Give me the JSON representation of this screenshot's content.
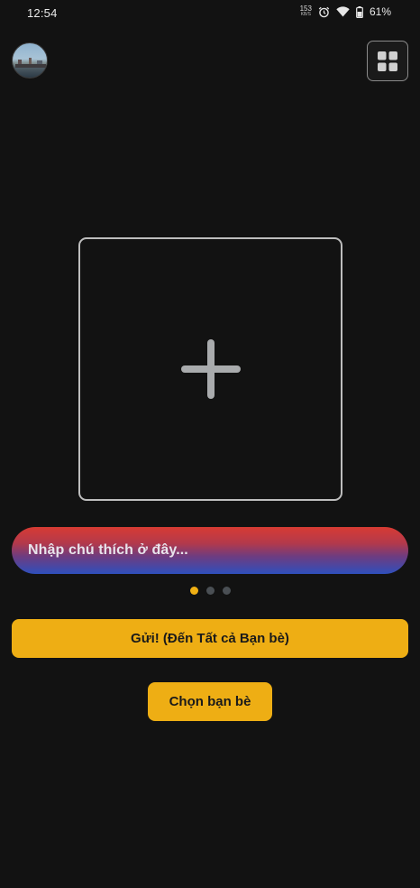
{
  "status_bar": {
    "time": "12:54",
    "net_speed_value": "153",
    "net_speed_unit": "KB/S",
    "alarm_icon": "alarm-icon",
    "wifi_icon": "wifi-icon",
    "battery_icon": "battery-icon",
    "battery_percent": "61%"
  },
  "header": {
    "avatar_icon": "profile-avatar",
    "grid_icon": "grid-icon"
  },
  "photo_slot": {
    "icon": "plus-icon"
  },
  "caption": {
    "placeholder": "Nhập chú thích ở đây..."
  },
  "pager": {
    "count": 3,
    "active_index": 0
  },
  "actions": {
    "send_label": "Gửi! (Đến Tất cả Bạn bè)",
    "pick_friends_label": "Chọn bạn bè"
  },
  "colors": {
    "background": "#121212",
    "accent": "#eeae14",
    "caption_gradient_top": "#d73b33",
    "caption_gradient_bottom": "#2e4fbd",
    "dot_inactive": "#4a4f54"
  }
}
